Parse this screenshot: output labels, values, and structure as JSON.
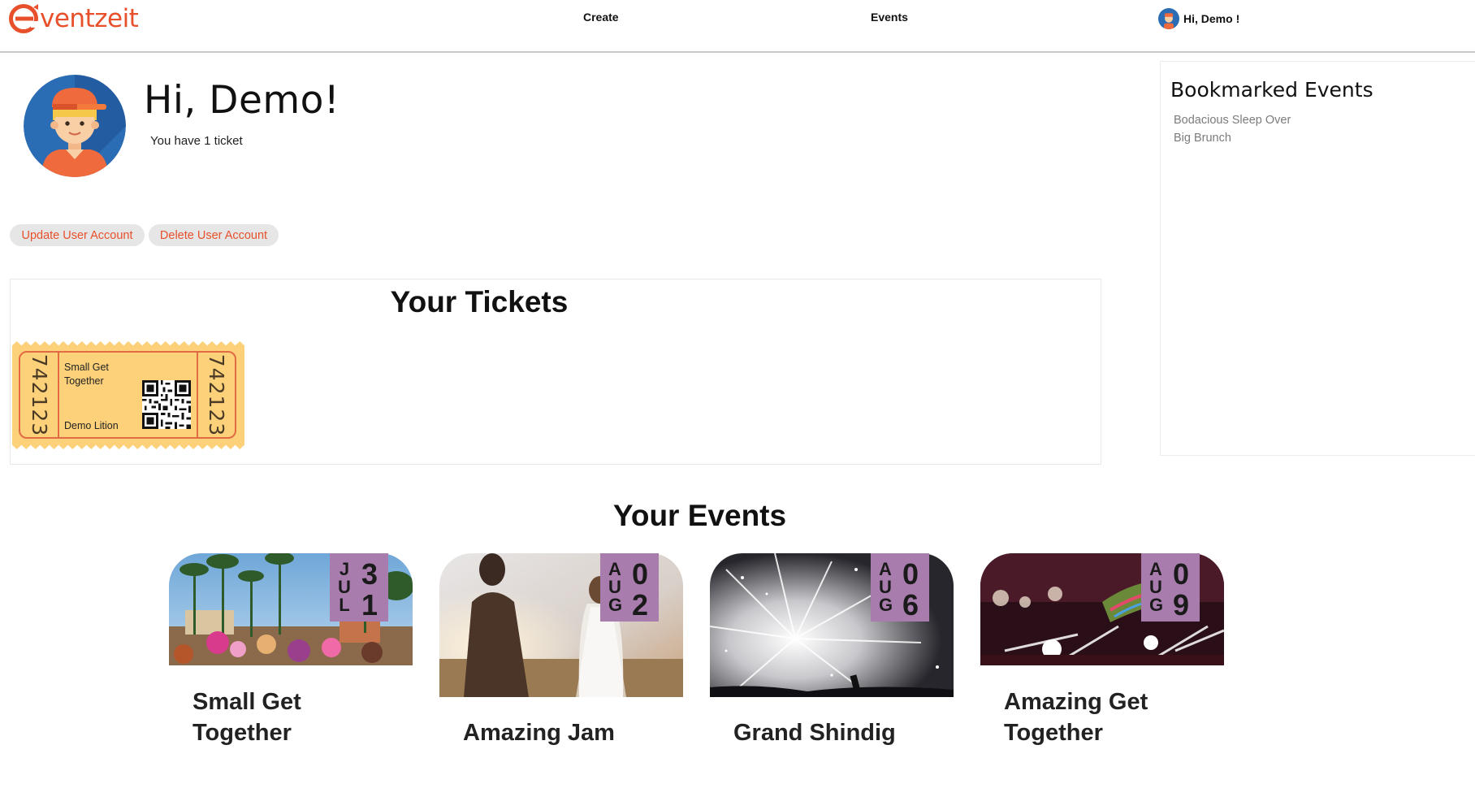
{
  "header": {
    "logo_text": "ventzeit",
    "nav_create": "Create",
    "nav_events": "Events",
    "nav_user": "Hi, Demo !"
  },
  "profile": {
    "greeting": "Hi, Demo!",
    "ticket_count": "You have 1 ticket",
    "update_button": "Update User Account",
    "delete_button": "Delete User Account"
  },
  "bookmarks": {
    "title": "Bookmarked Events",
    "items": [
      "Bodacious Sleep Over",
      "Big Brunch"
    ]
  },
  "tickets": {
    "title": "Your Tickets",
    "items": [
      {
        "number": "742123",
        "event": "Small Get Together",
        "holder": "Demo Lition"
      }
    ]
  },
  "events": {
    "title": "Your Events",
    "cards": [
      {
        "month": "JUL",
        "day": "31",
        "title": "Small Get Together"
      },
      {
        "month": "AUG",
        "day": "02",
        "title": "Amazing Jam"
      },
      {
        "month": "AUG",
        "day": "06",
        "title": "Grand Shindig"
      },
      {
        "month": "AUG",
        "day": "09",
        "title": "Amazing Get Together"
      }
    ]
  },
  "colors": {
    "brand": "#e8502b",
    "date_badge": "#a87cad",
    "ticket": "#fcd17a"
  }
}
